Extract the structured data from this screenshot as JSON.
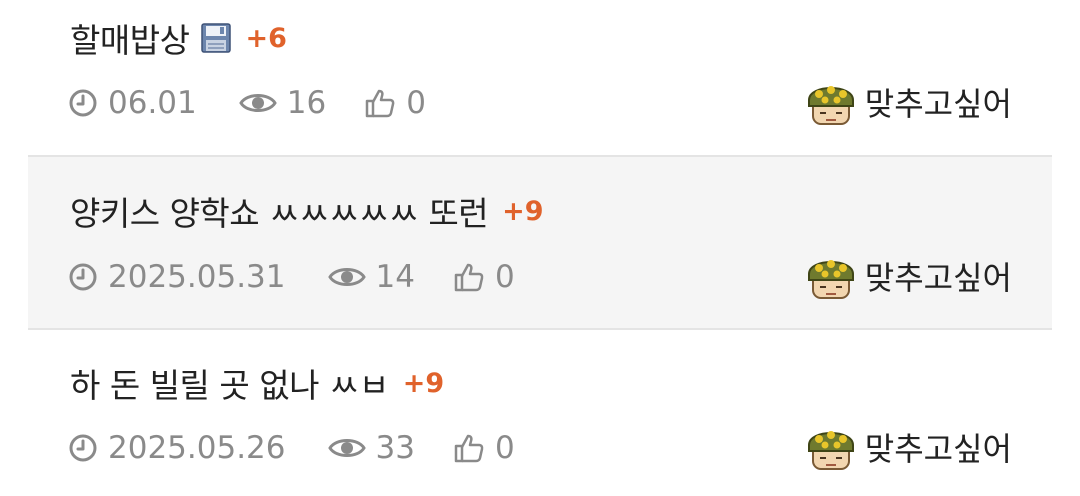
{
  "posts": [
    {
      "title": "할매밥상",
      "has_file_icon": true,
      "file_icon": "floppy-icon",
      "reply_count": "+6",
      "date": "06.01",
      "views": "16",
      "likes": "0",
      "author": "맞추고싶어"
    },
    {
      "title": "양키스 양학쇼 ㅆㅆㅆㅆㅆ 또런",
      "has_file_icon": false,
      "reply_count": "+9",
      "date": "2025.05.31",
      "views": "14",
      "likes": "0",
      "author": "맞추고싶어"
    },
    {
      "title": "하 돈 빌릴 곳 없나 ㅆㅂ",
      "has_file_icon": false,
      "reply_count": "+9",
      "date": "2025.05.26",
      "views": "33",
      "likes": "0",
      "author": "맞추고싶어"
    }
  ],
  "icons": {
    "date": "clock-icon",
    "views": "eye-icon",
    "likes": "thumbs-up-icon",
    "avatar": "soldier-helmet-avatar"
  },
  "colors": {
    "reply_count": "#e0622b",
    "meta_text": "#8a8a8a",
    "title_text": "#222222",
    "shaded_row": "#f5f5f5",
    "divider": "#e4e4e4"
  }
}
